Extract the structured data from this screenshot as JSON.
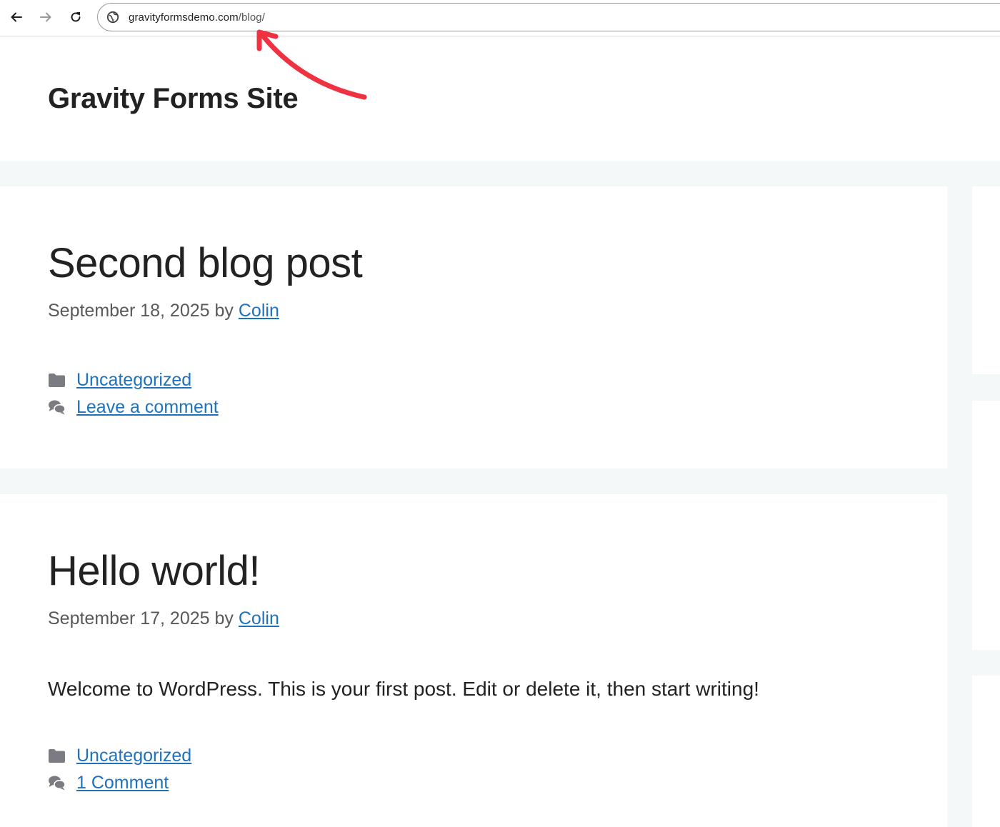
{
  "browser": {
    "url_host": "gravityformsdemo.com",
    "url_path": "/blog/",
    "icons": [
      "back-arrow-icon",
      "forward-arrow-icon",
      "reload-icon",
      "site-info-icon"
    ]
  },
  "site": {
    "title": "Gravity Forms Site"
  },
  "posts": [
    {
      "title": "Second blog post",
      "date": "September 18, 2025",
      "by": "by",
      "author": "Colin",
      "excerpt": "",
      "category": "Uncategorized",
      "comments": "Leave a comment"
    },
    {
      "title": "Hello world!",
      "date": "September 17, 2025",
      "by": "by",
      "author": "Colin",
      "excerpt": "Welcome to WordPress. This is your first post. Edit or delete it, then start writing!",
      "category": "Uncategorized",
      "comments": "1 Comment"
    }
  ],
  "colors": {
    "link": "#1e72bd",
    "annotation_arrow": "#ef3242",
    "page_background": "#f4f8f9",
    "icon_gray": "#7b7b82"
  }
}
